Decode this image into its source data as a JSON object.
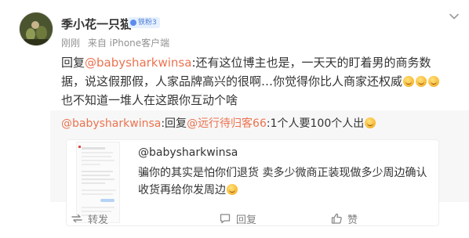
{
  "post": {
    "user": {
      "name": "季小花一只猫",
      "badge": "铁粉3"
    },
    "meta": {
      "time": "刚刚",
      "source": "来自 iPhone客户端"
    },
    "content": {
      "prefix": "回复",
      "mention": "@babysharkwinsa",
      "body": ":还有这位博主也是，一天天的盯着男的商务数据，说这假那假，人家品牌高兴的很啊…你觉得你比人商家还权威",
      "tail": "也不知道一堆人在这跟你互动个啥"
    }
  },
  "quote": {
    "author": "@babysharkwinsa",
    "reply_prefix": ":回复",
    "mention": "@远行待归客66",
    "body": ":1个人要100个人出",
    "inner": {
      "username": "@babysharkwinsa",
      "text": "骗你的其实是怕你们退货 卖多少微商正装现做多少周边确认收货再给你发周边"
    }
  },
  "actions": {
    "repost": "转发",
    "comment": "回复",
    "like": "赞"
  },
  "colors": {
    "mention": "#eb7350",
    "meta": "#939393",
    "quote_bg": "#f7f7f7",
    "action": "#808080"
  }
}
